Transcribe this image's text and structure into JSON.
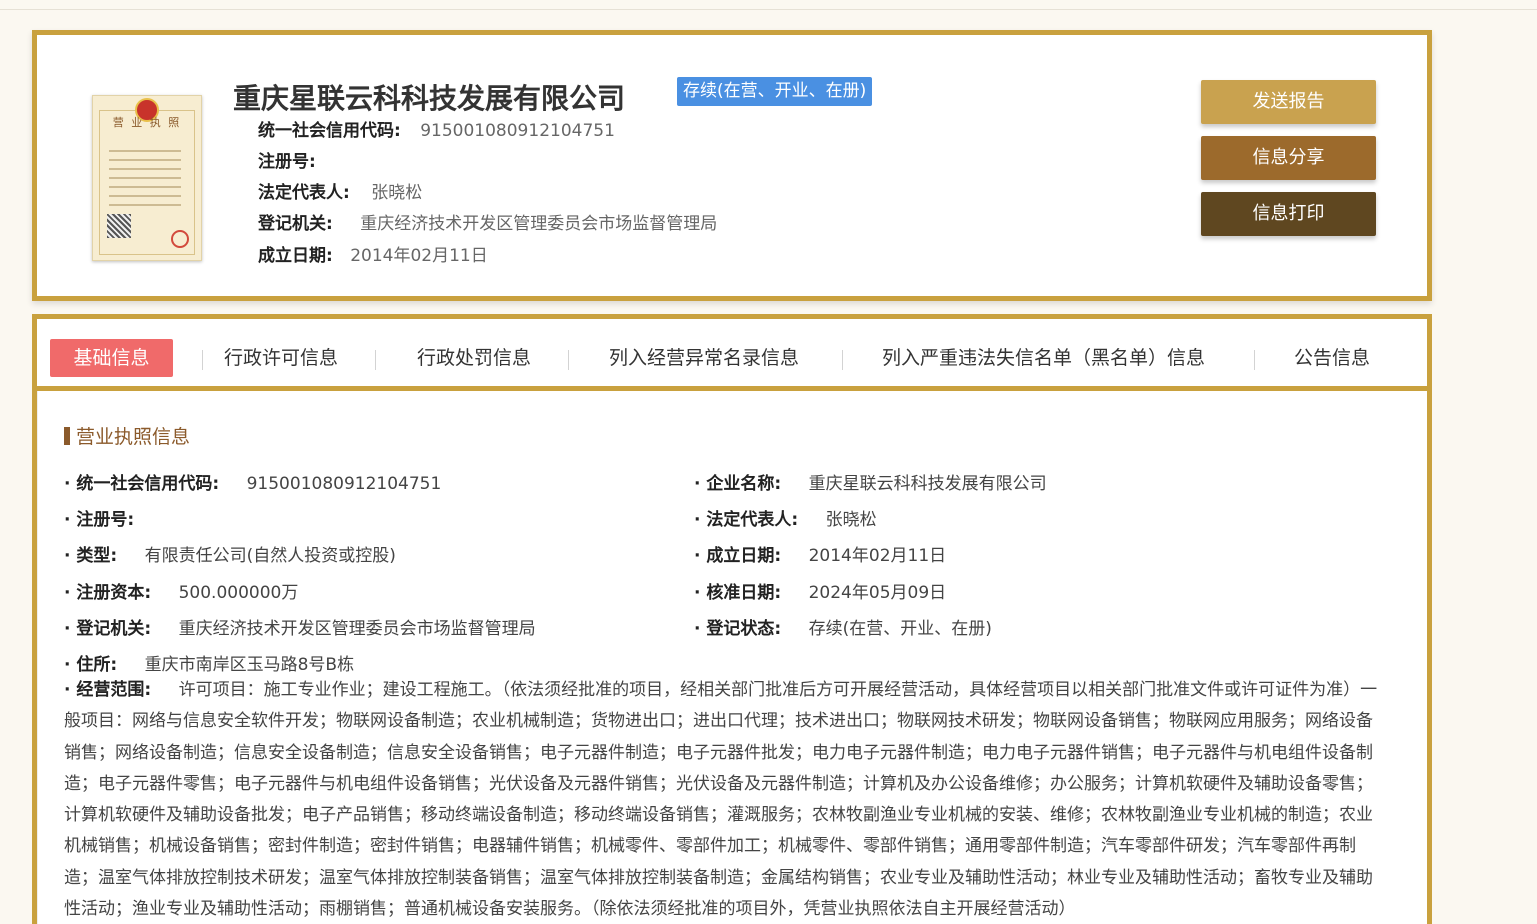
{
  "header": {
    "company_name": "重庆星联云科科技发展有限公司",
    "status": "存续(在营、开业、在册)",
    "license_image_title": "营 业 执 照",
    "fields": [
      {
        "label": "统一社会信用代码:",
        "value": "915001080912104751"
      },
      {
        "label": "注册号:",
        "value": ""
      },
      {
        "label": "法定代表人:",
        "value": "张晓松"
      },
      {
        "label": "登记机关:",
        "value": "重庆经济技术开发区管理委员会市场监督管理局"
      },
      {
        "label": "成立日期:",
        "value": "2014年02月11日"
      }
    ],
    "buttons": {
      "send_report": "发送报告",
      "share": "信息分享",
      "print": "信息打印"
    }
  },
  "tabs": [
    "基础信息",
    "行政许可信息",
    "行政处罚信息",
    "列入经营异常名录信息",
    "列入严重违法失信名单（黑名单）信息",
    "公告信息"
  ],
  "section": {
    "title": "营业执照信息",
    "left": [
      {
        "label": "统一社会信用代码:",
        "value": "915001080912104751"
      },
      {
        "label": "注册号:",
        "value": ""
      },
      {
        "label": "类型:",
        "value": "有限责任公司(自然人投资或控股)"
      },
      {
        "label": "注册资本:",
        "value": "500.000000万"
      },
      {
        "label": "登记机关:",
        "value": "重庆经济技术开发区管理委员会市场监督管理局"
      },
      {
        "label": "住所:",
        "value": "重庆市南岸区玉马路8号B栋"
      }
    ],
    "right": [
      {
        "label": "企业名称:",
        "value": "重庆星联云科科技发展有限公司"
      },
      {
        "label": "法定代表人:",
        "value": "张晓松"
      },
      {
        "label": "成立日期:",
        "value": "2014年02月11日"
      },
      {
        "label": "核准日期:",
        "value": "2024年05月09日"
      },
      {
        "label": "登记状态:",
        "value": "存续(在营、开业、在册)"
      }
    ],
    "scope_label": "经营范围:",
    "scope_value": "许可项目：施工专业作业；建设工程施工。（依法须经批准的项目，经相关部门批准后方可开展经营活动，具体经营项目以相关部门批准文件或许可证件为准）一般项目：网络与信息安全软件开发；物联网设备制造；农业机械制造；货物进出口；进出口代理；技术进出口；物联网技术研发；物联网设备销售；物联网应用服务；网络设备销售；网络设备制造；信息安全设备制造；信息安全设备销售；电子元器件制造；电子元器件批发；电力电子元器件制造；电力电子元器件销售；电子元器件与机电组件设备制造；电子元器件零售；电子元器件与机电组件设备销售；光伏设备及元器件销售；光伏设备及元器件制造；计算机及办公设备维修；办公服务；计算机软硬件及辅助设备零售；计算机软硬件及辅助设备批发；电子产品销售；移动终端设备制造；移动终端设备销售；灌溉服务；农林牧副渔业专业机械的安装、维修；农林牧副渔业专业机械的制造；农业机械销售；机械设备销售；密封件制造；密封件销售；电器辅件销售；机械零件、零部件加工；机械零件、零部件销售；通用零部件制造；汽车零部件研发；汽车零部件再制造；温室气体排放控制技术研发；温室气体排放控制装备销售；温室气体排放控制装备制造；金属结构销售；农业专业及辅助性活动；林业专业及辅助性活动；畜牧专业及辅助性活动；渔业专业及辅助性活动；雨棚销售；普通机械设备安装服务。（除依法须经批准的项目外，凭营业执照依法自主开展经营活动）"
  },
  "colors": {
    "accent_gold": "#c9a13e",
    "btn_send": "#c9a24f",
    "btn_share": "#9c6a2c",
    "btn_print": "#5f4720",
    "active_tab": "#f06a6a",
    "status_badge": "#4a90e2"
  }
}
